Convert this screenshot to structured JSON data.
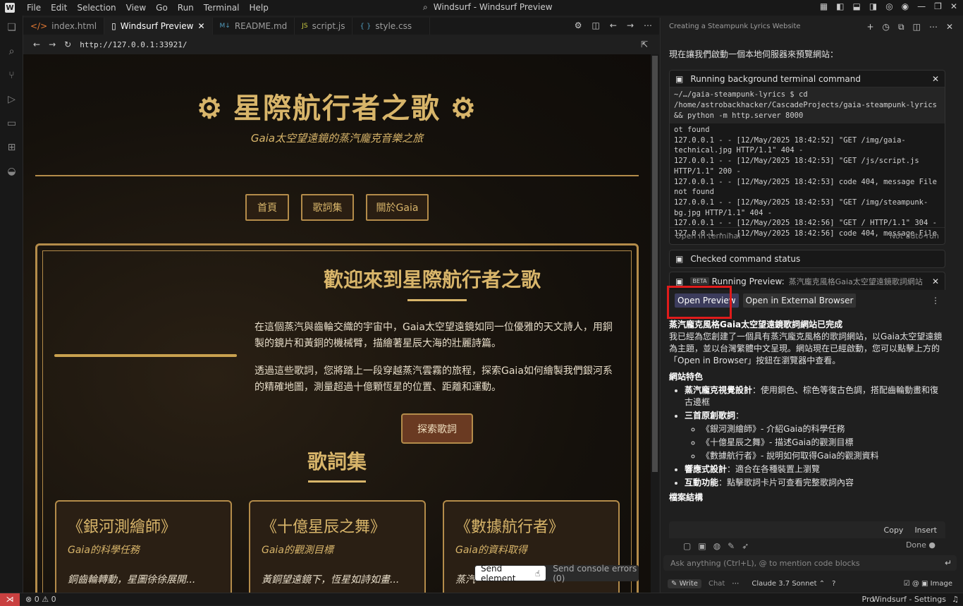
{
  "titlebar": {
    "menu": [
      "File",
      "Edit",
      "Selection",
      "View",
      "Go",
      "Run",
      "Terminal",
      "Help"
    ],
    "title": "Windsurf - Windsurf Preview"
  },
  "tabs": [
    {
      "label": "index.html",
      "icon": "</>"
    },
    {
      "label": "Windsurf Preview",
      "icon": "▯"
    },
    {
      "label": "README.md",
      "icon": "M↓"
    },
    {
      "label": "script.js",
      "icon": "JS"
    },
    {
      "label": "style.css",
      "icon": "{ }"
    }
  ],
  "url": "http://127.0.0.1:33921/",
  "site": {
    "title": "星際航行者之歌",
    "subtitle": "Gaia太空望遠鏡的蒸汽龐克音樂之旅",
    "nav": [
      "首頁",
      "歌詞集",
      "關於Gaia"
    ],
    "welcome": "歡迎來到星際航行者之歌",
    "para1": "在這個蒸汽與齒輪交織的宇宙中，Gaia太空望遠鏡如同一位優雅的天文詩人，用銅製的鏡片和黃銅的機械臂，描繪著星辰大海的壯麗詩篇。",
    "para2": "透過這些歌詞，您將踏上一段穿越蒸汽雲霧的旅程，探索Gaia如何繪製我們銀河系的精確地圖，測量超過十億顆恆星的位置、距離和運動。",
    "explore": "探索歌詞",
    "lyrics_heading": "歌詞集",
    "cards": [
      {
        "title": "《銀河測繪師》",
        "sub": "Gaia的科學任務",
        "text": "銅齒輪轉動，星圖徐徐展開..."
      },
      {
        "title": "《十億星辰之舞》",
        "sub": "Gaia的觀測目標",
        "text": "黃銅望遠鏡下，恆星如詩如畫..."
      },
      {
        "title": "《數據航行者》",
        "sub": "Gaia的資料取得",
        "text": "蒸汽"
      }
    ]
  },
  "sendbar": {
    "send": "Send element",
    "console": "Send console errors (0)"
  },
  "panel": {
    "title": "Creating a Steampunk Lyrics Website",
    "msg": "現在讓我們啟動一個本地伺服器來預覽網站：",
    "terminal_title": "Running background terminal command",
    "cmd": "~/…/gaia-steampunk-lyrics $ cd /home/astrobackhacker/CascadeProjects/gaia-steampunk-lyrics && python -m http.server 8000",
    "output": [
      "ot found",
      "127.0.0.1 - - [12/May/2025 18:42:52] \"GET /img/gaia-technical.jpg HTTP/1.1\" 404 -",
      "127.0.0.1 - - [12/May/2025 18:42:53] \"GET /js/script.js HTTP/1.1\" 200 -",
      "127.0.0.1 - - [12/May/2025 18:42:53] code 404, message File not found",
      "127.0.0.1 - - [12/May/2025 18:42:53] \"GET /img/steampunk-bg.jpg HTTP/1.1\" 404 -",
      "127.0.0.1 - - [12/May/2025 18:42:56] \"GET / HTTP/1.1\" 304 -",
      "127.0.0.1 - - [12/May/2025 18:42:56] code 404, message File n"
    ],
    "open_terminal": "Open in terminal",
    "not_auto": "Not auto-run",
    "checked": "Checked command status",
    "beta": "BETA",
    "running_preview": "Running Preview:",
    "preview_name": "蒸汽龐克風格Gaia太空望遠鏡歌詞網站",
    "open_preview": "Open Preview",
    "open_external": "Open in External Browser",
    "done_heading": "蒸汽龐克風格Gaia太空望遠鏡歌詞網站已完成",
    "done_text": "我已經為您創建了一個具有蒸汽龐克風格的歌詞網站，以Gaia太空望遠鏡為主題，並以台灣繁體中文呈現。網站現在已經啟動，您可以點擊上方的「Open in Browser」按鈕在瀏覽器中查看。",
    "features_heading": "網站特色",
    "f1b": "蒸汽龐克視覺設計",
    "f1": "：使用銅色、棕色等復古色調，搭配齒輪動畫和復古邊框",
    "f2b": "三首原創歌詞",
    "f2": "：",
    "songs": [
      "《銀河測繪師》- 介紹Gaia的科學任務",
      "《十億星辰之舞》- 描述Gaia的觀測目標",
      "《數據航行者》- 說明如何取得Gaia的觀測資料"
    ],
    "f3b": "響應式設計",
    "f3": "：適合在各種裝置上瀏覽",
    "f4b": "互動功能",
    "f4": "：點擊歌詞卡片可查看完整歌詞內容",
    "structure": "檔案結構",
    "copy": "Copy",
    "insert": "Insert",
    "done": "Done",
    "ask": "Ask anything (Ctrl+L), @ to mention code blocks",
    "write": "Write",
    "chat": "Chat",
    "model": "Claude 3.7 Sonnet",
    "image": "Image"
  },
  "status": {
    "errors": "0",
    "warnings": "0",
    "pro": "Pro",
    "settings": "Windsurf - Settings"
  }
}
